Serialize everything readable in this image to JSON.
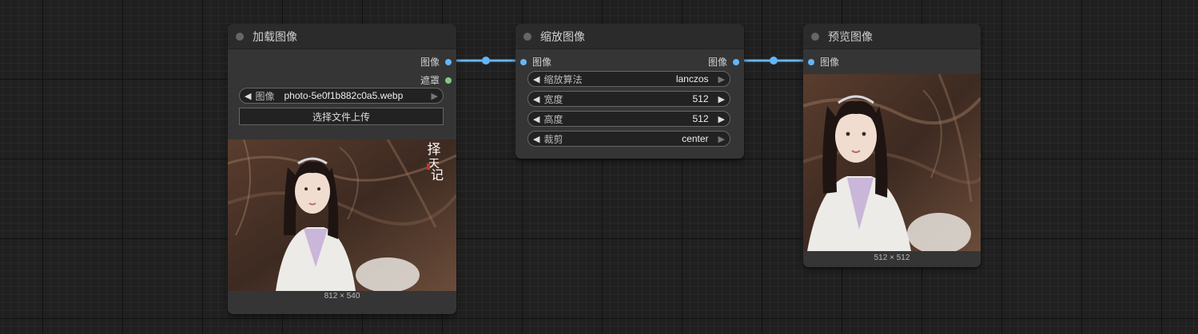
{
  "nodes": {
    "load": {
      "title": "加载图像",
      "outputs": [
        "图像",
        "遮罩"
      ],
      "widget_label": "图像",
      "widget_value": "photo-5e0f1b882c0a5.webp",
      "upload_label": "选择文件上传",
      "logo_text": "择天记",
      "size": "812 × 540"
    },
    "scale": {
      "title": "缩放图像",
      "input": "图像",
      "output": "图像",
      "widgets": [
        {
          "label": "缩放算法",
          "value": "lanczos"
        },
        {
          "label": "宽度",
          "value": "512"
        },
        {
          "label": "高度",
          "value": "512"
        },
        {
          "label": "裁剪",
          "value": "center"
        }
      ]
    },
    "preview": {
      "title": "预览图像",
      "input": "图像",
      "size": "512 × 512"
    }
  },
  "colors": {
    "link": "#64b5f6",
    "image_socket": "#64b5f6",
    "mask_socket": "#81c784"
  },
  "icons": [
    "node-status-dot",
    "arrow-left-icon",
    "arrow-right-icon"
  ]
}
